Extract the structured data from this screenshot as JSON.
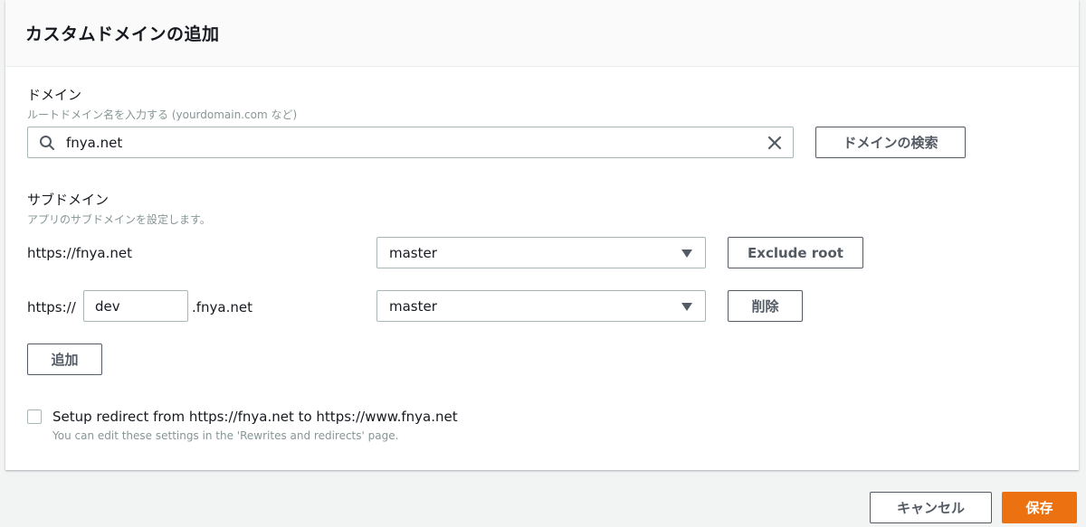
{
  "header": {
    "title": "カスタムドメインの追加"
  },
  "domain": {
    "label": "ドメイン",
    "hint": "ルートドメイン名を入力する (yourdomain.com など)",
    "search_value": "fnya.net",
    "search_button": "ドメインの検索"
  },
  "subdomain": {
    "label": "サブドメイン",
    "hint": "アプリのサブドメインを設定します。",
    "rows": [
      {
        "url": "https://fnya.net",
        "branch": "master",
        "action": "Exclude root"
      },
      {
        "prefix": "https://",
        "value": "dev",
        "suffix": ".fnya.net",
        "branch": "master",
        "action": "削除"
      }
    ],
    "add_button": "追加"
  },
  "redirect": {
    "label": "Setup redirect from https://fnya.net to https://www.fnya.net",
    "hint": "You can edit these settings in the 'Rewrites and redirects' page.",
    "checked": false
  },
  "footer": {
    "cancel": "キャンセル",
    "save": "保存"
  },
  "colors": {
    "primary": "#ec7211",
    "hint": "#879596",
    "border": "#aab7b8"
  }
}
